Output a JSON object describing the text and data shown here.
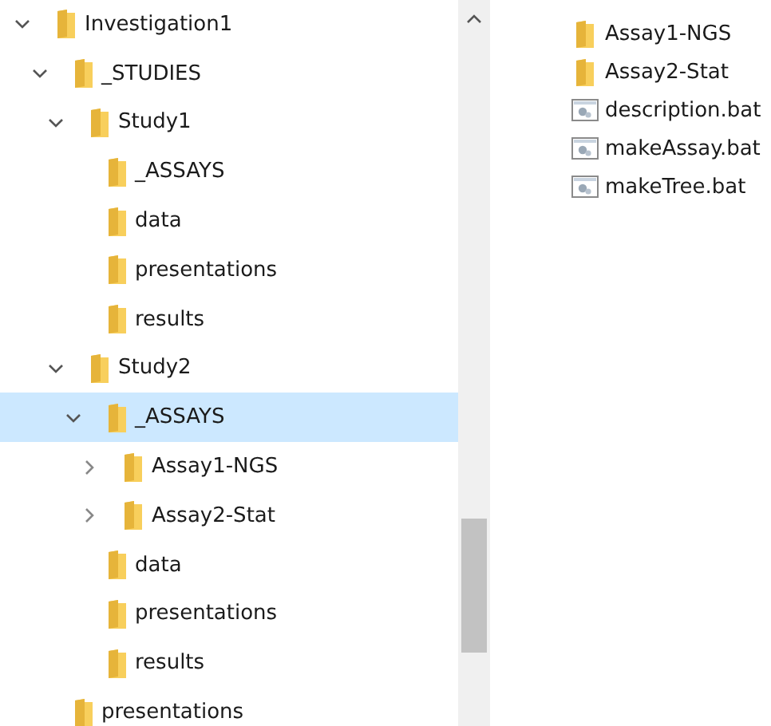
{
  "tree": [
    {
      "label": "Investigation1",
      "expanded": true,
      "selected": false,
      "children": [
        {
          "label": "_STUDIES",
          "expanded": true,
          "selected": false,
          "children": [
            {
              "label": "Study1",
              "expanded": true,
              "selected": false,
              "children": [
                {
                  "label": "_ASSAYS",
                  "selected": false
                },
                {
                  "label": "data",
                  "selected": false
                },
                {
                  "label": "presentations",
                  "selected": false
                },
                {
                  "label": "results",
                  "selected": false
                }
              ]
            },
            {
              "label": "Study2",
              "expanded": true,
              "selected": false,
              "children": [
                {
                  "label": "_ASSAYS",
                  "expanded": true,
                  "selected": true,
                  "children": [
                    {
                      "label": "Assay1-NGS",
                      "expanded": false,
                      "selected": false
                    },
                    {
                      "label": "Assay2-Stat",
                      "expanded": false,
                      "selected": false
                    }
                  ]
                },
                {
                  "label": "data",
                  "selected": false
                },
                {
                  "label": "presentations",
                  "selected": false
                },
                {
                  "label": "results",
                  "selected": false
                }
              ]
            }
          ]
        },
        {
          "label": "presentations",
          "selected": false
        }
      ]
    }
  ],
  "files": [
    {
      "name": "Assay1-NGS",
      "kind": "folder"
    },
    {
      "name": "Assay2-Stat",
      "kind": "folder"
    },
    {
      "name": "description.bat",
      "kind": "batch"
    },
    {
      "name": "makeAssay.bat",
      "kind": "batch"
    },
    {
      "name": "makeTree.bat",
      "kind": "batch"
    }
  ]
}
